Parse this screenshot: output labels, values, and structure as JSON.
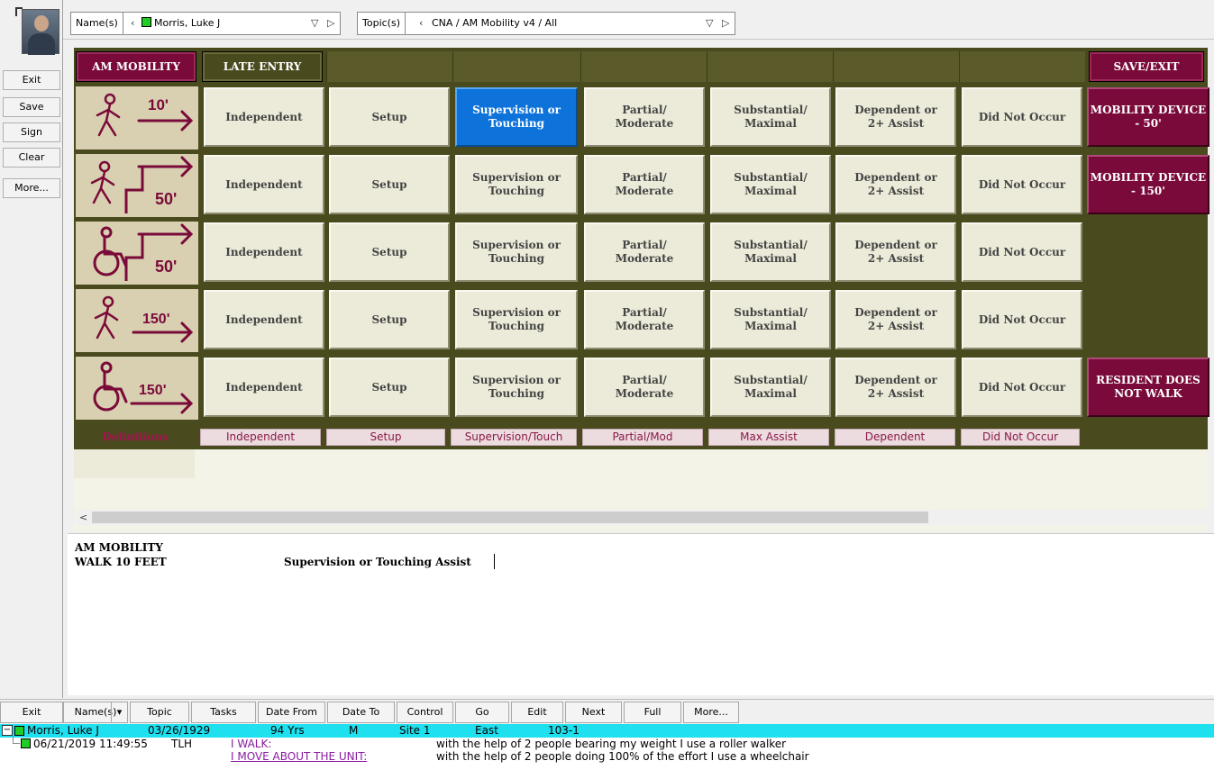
{
  "left_panel": {
    "buttons": [
      "Exit",
      "Save",
      "Sign",
      "Clear",
      "More..."
    ]
  },
  "top_toolbar": {
    "names_label": "Name(s)",
    "names_value": "Morris, Luke J",
    "topics_label": "Topic(s)",
    "topics_value": "CNA / AM Mobility v4 / All"
  },
  "grid": {
    "header": {
      "am_mobility": "AM MOBILITY",
      "late_entry": "LATE ENTRY",
      "save_exit": "SAVE/EXIT"
    },
    "rows": [
      {
        "icon": "walk-10ft-icon",
        "distance": "10'",
        "side_button": "MOBILITY DEVICE - 50'",
        "selected": 2
      },
      {
        "icon": "walk-stairs-50ft-icon",
        "distance": "50'",
        "side_button": "MOBILITY DEVICE - 150'",
        "selected": -1
      },
      {
        "icon": "wheelchair-50ft-icon",
        "distance": "50'",
        "side_button": "",
        "selected": -1
      },
      {
        "icon": "walk-150ft-icon",
        "distance": "150'",
        "side_button": "",
        "selected": -1
      },
      {
        "icon": "wheelchair-150ft-icon",
        "distance": "150'",
        "side_button": "RESIDENT DOES NOT WALK",
        "selected": -1
      }
    ],
    "options": [
      "Independent",
      "Setup",
      "Supervision or Touching",
      "Partial/ Moderate",
      "Substantial/ Maximal",
      "Dependent or 2+ Assist",
      "Did Not Occur"
    ],
    "definitions_label": "Definitions",
    "definitions": [
      "Independent",
      "Setup",
      "Supervision/Touch",
      "Partial/Mod",
      "Max Assist",
      "Dependent",
      "Did Not Occur"
    ]
  },
  "note": {
    "title": "AM MOBILITY",
    "item": "WALK 10 FEET",
    "value": "Supervision or Touching Assist"
  },
  "bottom_toolbar": [
    "Exit",
    "Name(s)",
    "Topic",
    "Tasks",
    "Date From",
    "Date To",
    "Control",
    "Go",
    "Edit",
    "Next",
    "Full",
    "More..."
  ],
  "patient": {
    "name": "Morris, Luke J",
    "dob": "03/26/1929",
    "age": "94 Yrs",
    "sex": "M",
    "site": "Site 1",
    "unit": "East",
    "room": "103-1",
    "entry_time": "06/21/2019 11:49:55",
    "entry_user": "TLH",
    "lines": [
      {
        "label": "I WALK:",
        "text": "with the help of 2 people bearing my weight I use a roller walker"
      },
      {
        "label": "I MOVE ABOUT THE UNIT:",
        "text": "with the help of 2 people doing 100% of the effort I use a wheelchair"
      }
    ]
  },
  "colors": {
    "maroon": "#7a0a3a",
    "olive": "#4a4a1f",
    "selected_blue": "#0d72d9",
    "patient_bar": "#1ee0ee",
    "option_bg": "#ecebd9"
  }
}
